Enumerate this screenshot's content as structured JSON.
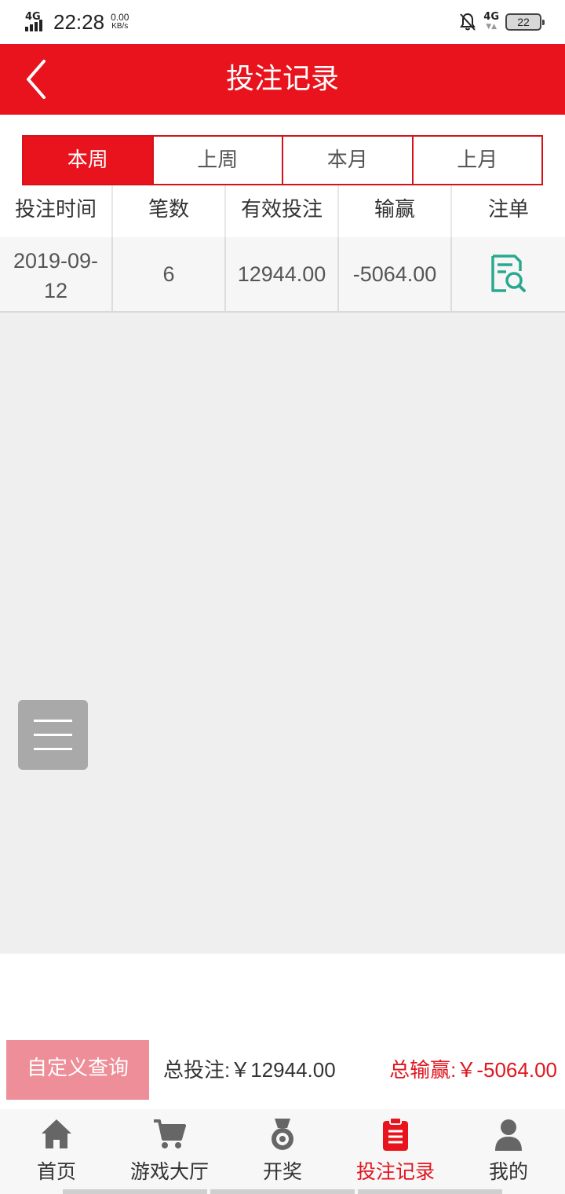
{
  "status_bar": {
    "network_type": "4G",
    "time": "22:28",
    "speed_value": "0.00",
    "speed_unit": "KB/s",
    "right_network": "4G",
    "battery": "22"
  },
  "header": {
    "title": "投注记录",
    "back_icon": "chevron-left-icon"
  },
  "tabs": [
    {
      "label": "本周",
      "active": true
    },
    {
      "label": "上周",
      "active": false
    },
    {
      "label": "本月",
      "active": false
    },
    {
      "label": "上月",
      "active": false
    }
  ],
  "table": {
    "columns": [
      "投注时间",
      "笔数",
      "有效投注",
      "输赢",
      "注单"
    ],
    "rows": [
      {
        "date_line1": "2019-09-",
        "date_line2": "12",
        "count": "6",
        "valid_bet": "12944.00",
        "win_loss": "-5064.00",
        "detail_icon": "document-search-icon"
      }
    ]
  },
  "summary": {
    "custom_query": "自定义查询",
    "total_bet": "总投注:￥12944.00",
    "total_win": "总输赢:￥-5064.00"
  },
  "nav": [
    {
      "label": "首页",
      "icon": "home-icon",
      "active": false
    },
    {
      "label": "游戏大厅",
      "icon": "cart-icon",
      "active": false
    },
    {
      "label": "开奖",
      "icon": "medal-icon",
      "active": false
    },
    {
      "label": "投注记录",
      "icon": "clipboard-icon",
      "active": true
    },
    {
      "label": "我的",
      "icon": "user-icon",
      "active": false
    }
  ],
  "colors": {
    "brand_red": "#e8131c",
    "custom_btn": "#ee8e98",
    "icon_teal": "#2aa88f",
    "nav_gray": "#666666"
  }
}
